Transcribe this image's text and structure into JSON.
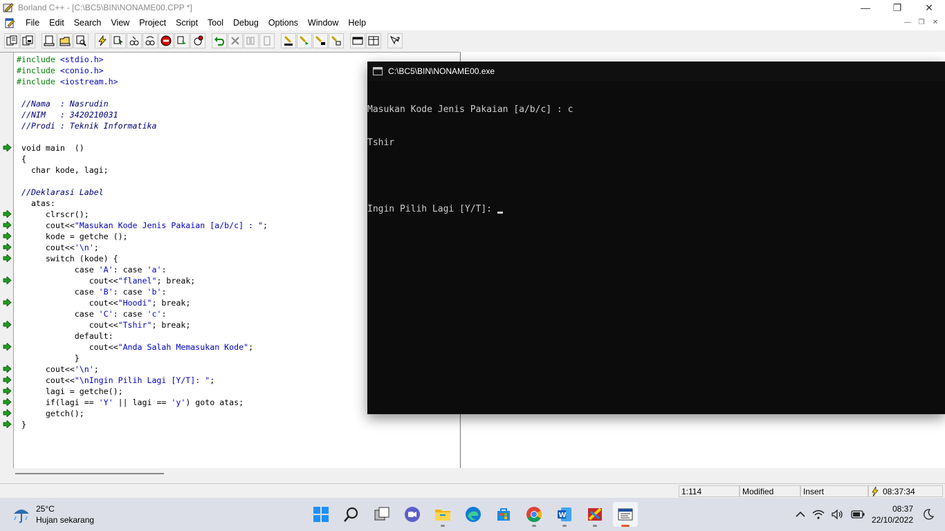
{
  "window": {
    "title": "Borland C++ - [C:\\BC5\\BIN\\NONAME00.CPP *]",
    "caption_buttons": [
      "minimize-icon",
      "restore-icon",
      "close-icon"
    ]
  },
  "menu": {
    "items": [
      "File",
      "Edit",
      "Search",
      "View",
      "Project",
      "Script",
      "Tool",
      "Debug",
      "Options",
      "Window",
      "Help"
    ]
  },
  "toolbar": {
    "buttons": [
      "open-project-icon",
      "save-project-icon",
      "new-file-icon",
      "open-file-icon",
      "find-icon",
      "lightning-icon",
      "make-icon",
      "build-icon",
      "step-icon",
      "stop-icon",
      "run-to-icon",
      "debug-icon",
      "undo-icon",
      "cut-icon",
      "copy-icon",
      "paste-icon",
      "toggle-breakpoint-icon",
      "inspect-icon",
      "evaluate-icon",
      "watch-icon",
      "window-icon",
      "tile-icon",
      "help-icon"
    ]
  },
  "editor": {
    "lines": [
      {
        "parts": [
          {
            "t": "#include ",
            "c": "pp"
          },
          {
            "t": "<stdio.h>",
            "c": "str"
          }
        ]
      },
      {
        "parts": [
          {
            "t": "#include ",
            "c": "pp"
          },
          {
            "t": "<conio.h>",
            "c": "str"
          }
        ]
      },
      {
        "parts": [
          {
            "t": "#include ",
            "c": "pp"
          },
          {
            "t": "<iostream.h>",
            "c": "str"
          }
        ]
      },
      {
        "parts": [
          {
            "t": "",
            "c": "kw"
          }
        ]
      },
      {
        "parts": [
          {
            "t": " //Nama  : Nasrudin",
            "c": "cm"
          }
        ]
      },
      {
        "parts": [
          {
            "t": " //NIM   : 3420210031",
            "c": "cm"
          }
        ]
      },
      {
        "parts": [
          {
            "t": " //Prodi : Teknik Informatika",
            "c": "cm"
          }
        ]
      },
      {
        "parts": [
          {
            "t": "",
            "c": "kw"
          }
        ]
      },
      {
        "parts": [
          {
            "t": " void main  ()",
            "c": "kw"
          }
        ]
      },
      {
        "parts": [
          {
            "t": " {",
            "c": "kw"
          }
        ]
      },
      {
        "parts": [
          {
            "t": "   char kode, lagi;",
            "c": "kw"
          }
        ]
      },
      {
        "parts": [
          {
            "t": "",
            "c": "kw"
          }
        ]
      },
      {
        "parts": [
          {
            "t": " //Deklarasi Label",
            "c": "cm"
          }
        ]
      },
      {
        "parts": [
          {
            "t": "   atas:",
            "c": "kw"
          }
        ]
      },
      {
        "parts": [
          {
            "t": "      clrscr();",
            "c": "kw"
          }
        ]
      },
      {
        "parts": [
          {
            "t": "      cout<<",
            "c": "kw"
          },
          {
            "t": "\"Masukan Kode Jenis Pakaian [a/b/c] : \"",
            "c": "str"
          },
          {
            "t": ";",
            "c": "kw"
          }
        ]
      },
      {
        "parts": [
          {
            "t": "      kode = getche ();",
            "c": "kw"
          }
        ]
      },
      {
        "parts": [
          {
            "t": "      cout<<",
            "c": "kw"
          },
          {
            "t": "'\\n'",
            "c": "str"
          },
          {
            "t": ";",
            "c": "kw"
          }
        ]
      },
      {
        "parts": [
          {
            "t": "      switch (kode) {",
            "c": "kw"
          }
        ]
      },
      {
        "parts": [
          {
            "t": "            case ",
            "c": "kw"
          },
          {
            "t": "'A'",
            "c": "str"
          },
          {
            "t": ": case ",
            "c": "kw"
          },
          {
            "t": "'a'",
            "c": "str"
          },
          {
            "t": ":",
            "c": "kw"
          }
        ]
      },
      {
        "parts": [
          {
            "t": "               cout<<",
            "c": "kw"
          },
          {
            "t": "\"flanel\"",
            "c": "str"
          },
          {
            "t": "; break;",
            "c": "kw"
          }
        ]
      },
      {
        "parts": [
          {
            "t": "            case ",
            "c": "kw"
          },
          {
            "t": "'B'",
            "c": "str"
          },
          {
            "t": ": case ",
            "c": "kw"
          },
          {
            "t": "'b'",
            "c": "str"
          },
          {
            "t": ":",
            "c": "kw"
          }
        ]
      },
      {
        "parts": [
          {
            "t": "               cout<<",
            "c": "kw"
          },
          {
            "t": "\"Hoodi\"",
            "c": "str"
          },
          {
            "t": "; break;",
            "c": "kw"
          }
        ]
      },
      {
        "parts": [
          {
            "t": "            case ",
            "c": "kw"
          },
          {
            "t": "'C'",
            "c": "str"
          },
          {
            "t": ": case ",
            "c": "kw"
          },
          {
            "t": "'c'",
            "c": "str"
          },
          {
            "t": ":",
            "c": "kw"
          }
        ]
      },
      {
        "parts": [
          {
            "t": "               cout<<",
            "c": "kw"
          },
          {
            "t": "\"Tshir\"",
            "c": "str"
          },
          {
            "t": "; break;",
            "c": "kw"
          }
        ]
      },
      {
        "parts": [
          {
            "t": "            default:",
            "c": "kw"
          }
        ]
      },
      {
        "parts": [
          {
            "t": "               cout<<",
            "c": "kw"
          },
          {
            "t": "\"Anda Salah Memasukan Kode\"",
            "c": "str"
          },
          {
            "t": ";",
            "c": "kw"
          }
        ]
      },
      {
        "parts": [
          {
            "t": "            }",
            "c": "kw"
          }
        ]
      },
      {
        "parts": [
          {
            "t": "      cout<<",
            "c": "kw"
          },
          {
            "t": "'\\n'",
            "c": "str"
          },
          {
            "t": ";",
            "c": "kw"
          }
        ]
      },
      {
        "parts": [
          {
            "t": "      cout<<",
            "c": "kw"
          },
          {
            "t": "\"\\nIngin Pilih Lagi [Y/T]: \"",
            "c": "str"
          },
          {
            "t": ";",
            "c": "kw"
          }
        ]
      },
      {
        "parts": [
          {
            "t": "      lagi = getche();",
            "c": "kw"
          }
        ]
      },
      {
        "parts": [
          {
            "t": "      if(lagi == ",
            "c": "kw"
          },
          {
            "t": "'Y'",
            "c": "str"
          },
          {
            "t": " || lagi == ",
            "c": "kw"
          },
          {
            "t": "'y'",
            "c": "str"
          },
          {
            "t": ") goto atas;",
            "c": "kw"
          }
        ]
      },
      {
        "parts": [
          {
            "t": "      getch();",
            "c": "kw"
          }
        ]
      },
      {
        "parts": [
          {
            "t": " }",
            "c": "kw"
          }
        ]
      }
    ],
    "breakpoint_lines": [
      8,
      14,
      15,
      16,
      17,
      18,
      20,
      22,
      24,
      26,
      28,
      29,
      30,
      31,
      32,
      33
    ]
  },
  "console": {
    "title": "C:\\BC5\\BIN\\NONAME00.exe",
    "lines": [
      "Masukan Kode Jenis Pakaian [a/b/c] : c",
      "Tshir",
      "",
      "Ingin Pilih Lagi [Y/T]: "
    ]
  },
  "status": {
    "position": "1:114",
    "modified": "Modified",
    "mode": "Insert",
    "time": "08:37:34"
  },
  "taskbar": {
    "weather_temp": "25°C",
    "weather_desc": "Hujan sekarang",
    "apps": [
      "windows-start-icon",
      "search-icon",
      "task-view-icon",
      "teams-chat-icon",
      "file-explorer-icon",
      "edge-icon",
      "store-icon",
      "chrome-icon",
      "word-icon",
      "borland-icon",
      "ide-window-icon"
    ],
    "clock_time": "08:37",
    "clock_date": "22/10/2022"
  }
}
